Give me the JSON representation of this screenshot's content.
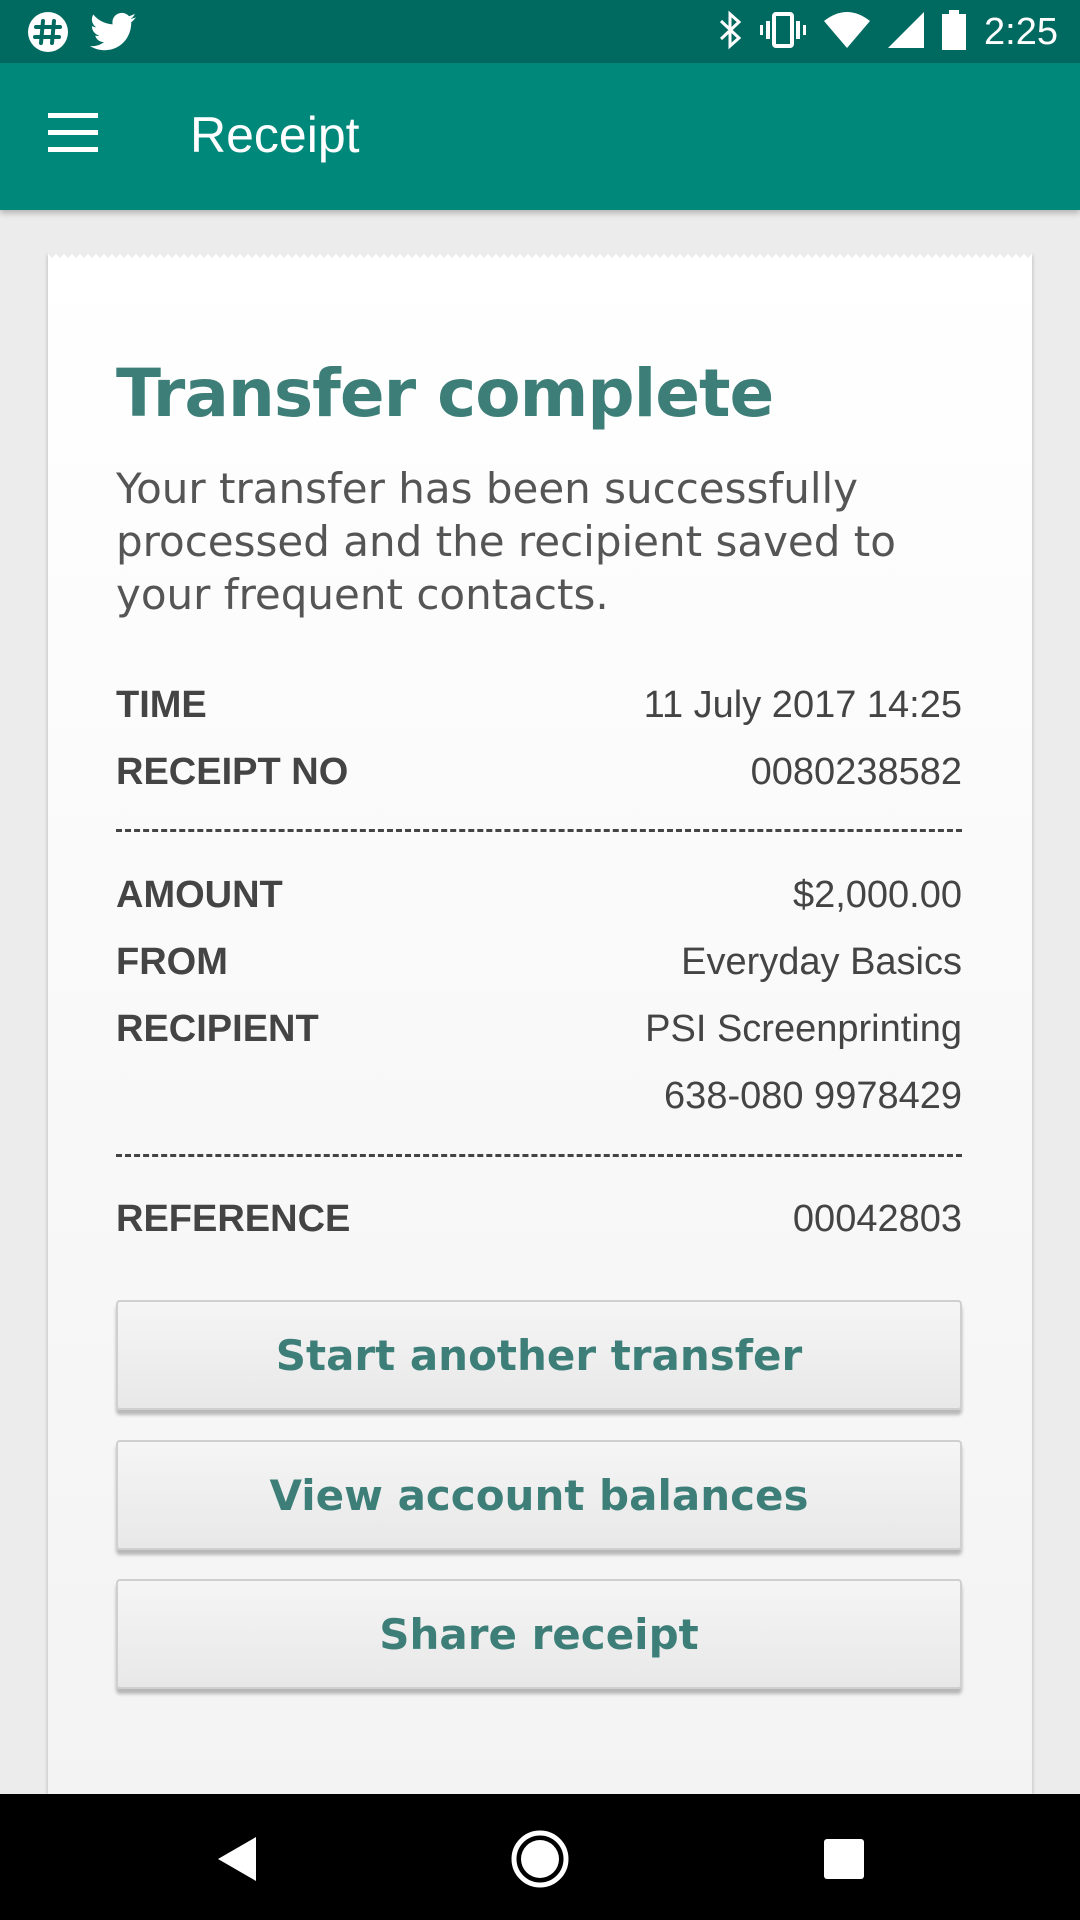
{
  "status_bar": {
    "time": "2:25",
    "left_icons": [
      "slack-icon",
      "twitter-icon"
    ],
    "right_icons": [
      "bluetooth-icon",
      "vibrate-icon",
      "wifi-icon",
      "cell-signal-icon",
      "battery-icon"
    ]
  },
  "app_bar": {
    "title": "Receipt",
    "menu_icon": "hamburger-menu-icon"
  },
  "receipt": {
    "heading": "Transfer complete",
    "message": "Your transfer has been successfully processed and the recipient saved to your frequent contacts.",
    "time_label": "TIME",
    "time_value": "11 July 2017 14:25",
    "receipt_no_label": "RECEIPT NO",
    "receipt_no_value": "0080238582",
    "amount_label": "AMOUNT",
    "amount_value": "$2,000.00",
    "from_label": "FROM",
    "from_value": "Everyday Basics",
    "recipient_label": "RECIPIENT",
    "recipient_name": "PSI Screenprinting",
    "recipient_account": "638-080 9978429",
    "reference_label": "REFERENCE",
    "reference_value": "00042803"
  },
  "actions": {
    "start_transfer": "Start another transfer",
    "view_balances": "View account balances",
    "share_receipt": "Share receipt"
  },
  "colors": {
    "status_bar": "#006a60",
    "app_bar": "#00897b",
    "accent_text": "#3d7f78"
  },
  "nav_bar": {
    "icons": [
      "back-icon",
      "home-icon",
      "recents-icon"
    ]
  }
}
